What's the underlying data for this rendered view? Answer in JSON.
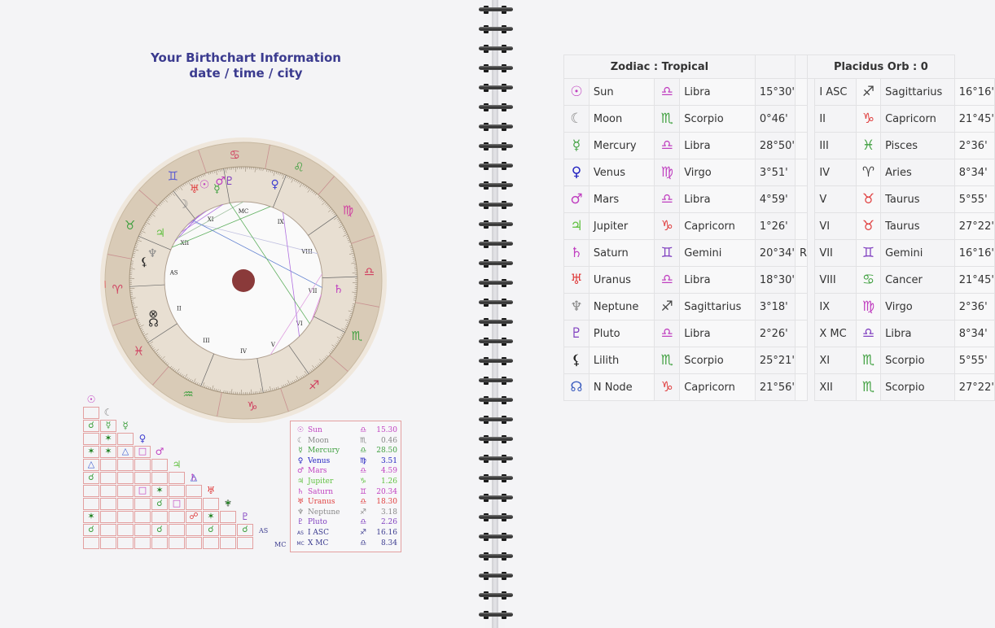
{
  "header": {
    "title_line1": "Your Birthchart Information",
    "title_line2": "date / time / city"
  },
  "wheel": {
    "signs": [
      {
        "glyph": "♈",
        "color": "#d04060"
      },
      {
        "glyph": "♉",
        "color": "#40a040"
      },
      {
        "glyph": "♊",
        "color": "#6060d0"
      },
      {
        "glyph": "♋",
        "color": "#d04060"
      },
      {
        "glyph": "♌",
        "color": "#40a040"
      },
      {
        "glyph": "♍",
        "color": "#d040a0"
      },
      {
        "glyph": "♎",
        "color": "#d04060"
      },
      {
        "glyph": "♏",
        "color": "#40a040"
      },
      {
        "glyph": "♐",
        "color": "#d04060"
      },
      {
        "glyph": "♑",
        "color": "#d04060"
      },
      {
        "glyph": "♒",
        "color": "#40a040"
      },
      {
        "glyph": "♓",
        "color": "#d04060"
      }
    ],
    "house_labels": [
      "AS",
      "XII",
      "XI",
      "MC",
      "IX",
      "VIII",
      "VII",
      "VI",
      "V",
      "IV",
      "III",
      "II"
    ],
    "planet_glyphs": [
      {
        "glyph": "☉",
        "color": "#c040c0"
      },
      {
        "glyph": "☽",
        "color": "#888888"
      },
      {
        "glyph": "☿",
        "color": "#40a040"
      },
      {
        "glyph": "♀",
        "color": "#4040d0"
      },
      {
        "glyph": "♂",
        "color": "#c040c0"
      },
      {
        "glyph": "♃",
        "color": "#60c040"
      },
      {
        "glyph": "♄",
        "color": "#c040c0"
      },
      {
        "glyph": "♅",
        "color": "#e04040"
      },
      {
        "glyph": "♆",
        "color": "#888888"
      },
      {
        "glyph": "♇",
        "color": "#8040c0"
      },
      {
        "glyph": "⚸",
        "color": "#222222"
      },
      {
        "glyph": "☊",
        "color": "#222222"
      },
      {
        "glyph": "⊗",
        "color": "#222222"
      }
    ]
  },
  "aspect_grid": {
    "headers": [
      {
        "glyph": "☉",
        "color": "#c040c0"
      },
      {
        "glyph": "☾",
        "color": "#888888"
      },
      {
        "glyph": "☿",
        "color": "#40a040"
      },
      {
        "glyph": "♀",
        "color": "#4040d0"
      },
      {
        "glyph": "♂",
        "color": "#c040c0"
      },
      {
        "glyph": "♃",
        "color": "#60c040"
      },
      {
        "glyph": "♄",
        "color": "#c040c0"
      },
      {
        "glyph": "♅",
        "color": "#e04040"
      },
      {
        "glyph": "♆",
        "color": "#888888"
      },
      {
        "glyph": "♇",
        "color": "#8040c0"
      }
    ],
    "as_label": "AS",
    "mc_label": "MC",
    "marks": [
      {
        "row": 2,
        "col": 0,
        "glyph": "☌",
        "color": "#40a040"
      },
      {
        "row": 2,
        "col": 1,
        "glyph": "☿",
        "color": "#40a040"
      },
      {
        "row": 3,
        "col": 1,
        "glyph": "✶",
        "color": "#208020"
      },
      {
        "row": 4,
        "col": 0,
        "glyph": "✶",
        "color": "#208020"
      },
      {
        "row": 4,
        "col": 1,
        "glyph": "✶",
        "color": "#208020"
      },
      {
        "row": 4,
        "col": 2,
        "glyph": "△",
        "color": "#4060d0"
      },
      {
        "row": 4,
        "col": 3,
        "glyph": "□",
        "color": "#c040c0"
      },
      {
        "row": 5,
        "col": 0,
        "glyph": "△",
        "color": "#4060d0"
      },
      {
        "row": 6,
        "col": 0,
        "glyph": "☌",
        "color": "#40a040"
      },
      {
        "row": 6,
        "col": 6,
        "glyph": "△",
        "color": "#4060d0"
      },
      {
        "row": 7,
        "col": 3,
        "glyph": "□",
        "color": "#c040c0"
      },
      {
        "row": 7,
        "col": 4,
        "glyph": "✶",
        "color": "#208020"
      },
      {
        "row": 8,
        "col": 4,
        "glyph": "☌",
        "color": "#40a040"
      },
      {
        "row": 8,
        "col": 5,
        "glyph": "□",
        "color": "#c040c0"
      },
      {
        "row": 8,
        "col": 8,
        "glyph": "✶",
        "color": "#208020"
      },
      {
        "row": 9,
        "col": 0,
        "glyph": "✶",
        "color": "#208020"
      },
      {
        "row": 9,
        "col": 6,
        "glyph": "☍",
        "color": "#e04040"
      },
      {
        "row": 9,
        "col": 7,
        "glyph": "✶",
        "color": "#208020"
      },
      {
        "row": 10,
        "col": 0,
        "glyph": "☌",
        "color": "#40a040"
      },
      {
        "row": 10,
        "col": 4,
        "glyph": "☌",
        "color": "#40a040"
      },
      {
        "row": 10,
        "col": 7,
        "glyph": "☌",
        "color": "#40a040"
      },
      {
        "row": 10,
        "col": 9,
        "glyph": "☌",
        "color": "#40a040"
      }
    ]
  },
  "legend": [
    {
      "glyph": "☉",
      "name": "Sun",
      "sign": "♎",
      "deg": "15.30",
      "color": "#c040c0"
    },
    {
      "glyph": "☾",
      "name": "Moon",
      "sign": "♏",
      "deg": "0.46",
      "color": "#888888"
    },
    {
      "glyph": "☿",
      "name": "Mercury",
      "sign": "♎",
      "deg": "28.50",
      "color": "#40a040"
    },
    {
      "glyph": "♀",
      "name": "Venus",
      "sign": "♍",
      "deg": "3.51",
      "color": "#2020c0"
    },
    {
      "glyph": "♂",
      "name": "Mars",
      "sign": "♎",
      "deg": "4.59",
      "color": "#c040c0"
    },
    {
      "glyph": "♃",
      "name": "Jupiter",
      "sign": "♑",
      "deg": "1.26",
      "color": "#60c040"
    },
    {
      "glyph": "♄",
      "name": "Saturn",
      "sign": "♊",
      "deg": "20.34",
      "color": "#c040c0"
    },
    {
      "glyph": "♅",
      "name": "Uranus",
      "sign": "♎",
      "deg": "18.30",
      "color": "#e04040"
    },
    {
      "glyph": "♆",
      "name": "Neptune",
      "sign": "♐",
      "deg": "3.18",
      "color": "#888888"
    },
    {
      "glyph": "♇",
      "name": "Pluto",
      "sign": "♎",
      "deg": "2.26",
      "color": "#8040c0"
    },
    {
      "glyph": "AS",
      "name": "I ASC",
      "sign": "♐",
      "deg": "16.16",
      "color": "#3b3b8f"
    },
    {
      "glyph": "MC",
      "name": "X MC",
      "sign": "♎",
      "deg": "8.34",
      "color": "#3b3b8f"
    }
  ],
  "table": {
    "header_left": "Zodiac : Tropical",
    "header_right": "Placidus Orb : 0",
    "rows": [
      {
        "pg": "☉",
        "pgc": "#c040c0",
        "planet": "Sun",
        "sg": "♎",
        "sgc": "#c040c0",
        "sign": "Libra",
        "deg": "15°30'",
        "r": "",
        "house": "I ASC",
        "hg": "♐",
        "hgc": "#444444",
        "hsign": "Sagittarius",
        "hdeg": "16°16'"
      },
      {
        "pg": "☾",
        "pgc": "#888888",
        "planet": "Moon",
        "sg": "♏",
        "sgc": "#40a040",
        "sign": "Scorpio",
        "deg": "0°46'",
        "r": "",
        "house": "II",
        "hg": "♑",
        "hgc": "#e04040",
        "hsign": "Capricorn",
        "hdeg": "21°45'"
      },
      {
        "pg": "☿",
        "pgc": "#40a040",
        "planet": "Mercury",
        "sg": "♎",
        "sgc": "#c040c0",
        "sign": "Libra",
        "deg": "28°50'",
        "r": "",
        "house": "III",
        "hg": "♓",
        "hgc": "#40a040",
        "hsign": "Pisces",
        "hdeg": "2°36'"
      },
      {
        "pg": "♀",
        "pgc": "#2020c0",
        "planet": "Venus",
        "sg": "♍",
        "sgc": "#c040c0",
        "sign": "Virgo",
        "deg": "3°51'",
        "r": "",
        "house": "IV",
        "hg": "♈",
        "hgc": "#444444",
        "hsign": "Aries",
        "hdeg": "8°34'"
      },
      {
        "pg": "♂",
        "pgc": "#c040c0",
        "planet": "Mars",
        "sg": "♎",
        "sgc": "#c040c0",
        "sign": "Libra",
        "deg": "4°59'",
        "r": "",
        "house": "V",
        "hg": "♉",
        "hgc": "#e04040",
        "hsign": "Taurus",
        "hdeg": "5°55'"
      },
      {
        "pg": "♃",
        "pgc": "#60c040",
        "planet": "Jupiter",
        "sg": "♑",
        "sgc": "#e04040",
        "sign": "Capricorn",
        "deg": "1°26'",
        "r": "",
        "house": "VI",
        "hg": "♉",
        "hgc": "#e04040",
        "hsign": "Taurus",
        "hdeg": "27°22'"
      },
      {
        "pg": "♄",
        "pgc": "#c040c0",
        "planet": "Saturn",
        "sg": "♊",
        "sgc": "#8040c0",
        "sign": "Gemini",
        "deg": "20°34'",
        "r": "R",
        "house": "VII",
        "hg": "♊",
        "hgc": "#8040c0",
        "hsign": "Gemini",
        "hdeg": "16°16'"
      },
      {
        "pg": "♅",
        "pgc": "#e04040",
        "planet": "Uranus",
        "sg": "♎",
        "sgc": "#c040c0",
        "sign": "Libra",
        "deg": "18°30'",
        "r": "",
        "house": "VIII",
        "hg": "♋",
        "hgc": "#40a040",
        "hsign": "Cancer",
        "hdeg": "21°45'"
      },
      {
        "pg": "♆",
        "pgc": "#888888",
        "planet": "Neptune",
        "sg": "♐",
        "sgc": "#444444",
        "sign": "Sagittarius",
        "deg": "3°18'",
        "r": "",
        "house": "IX",
        "hg": "♍",
        "hgc": "#c040c0",
        "hsign": "Virgo",
        "hdeg": "2°36'"
      },
      {
        "pg": "♇",
        "pgc": "#8040c0",
        "planet": "Pluto",
        "sg": "♎",
        "sgc": "#c040c0",
        "sign": "Libra",
        "deg": "2°26'",
        "r": "",
        "house": "X MC",
        "hg": "♎",
        "hgc": "#8040c0",
        "hsign": "Libra",
        "hdeg": "8°34'"
      },
      {
        "pg": "⚸",
        "pgc": "#222222",
        "planet": "Lilith",
        "sg": "♏",
        "sgc": "#40a040",
        "sign": "Scorpio",
        "deg": "25°21'",
        "r": "",
        "house": "XI",
        "hg": "♏",
        "hgc": "#40a040",
        "hsign": "Scorpio",
        "hdeg": "5°55'"
      },
      {
        "pg": "☊",
        "pgc": "#4060c0",
        "planet": "N Node",
        "sg": "♑",
        "sgc": "#e04040",
        "sign": "Capricorn",
        "deg": "21°56'",
        "r": "",
        "house": "XII",
        "hg": "♏",
        "hgc": "#40a040",
        "hsign": "Scorpio",
        "hdeg": "27°22'"
      }
    ]
  }
}
